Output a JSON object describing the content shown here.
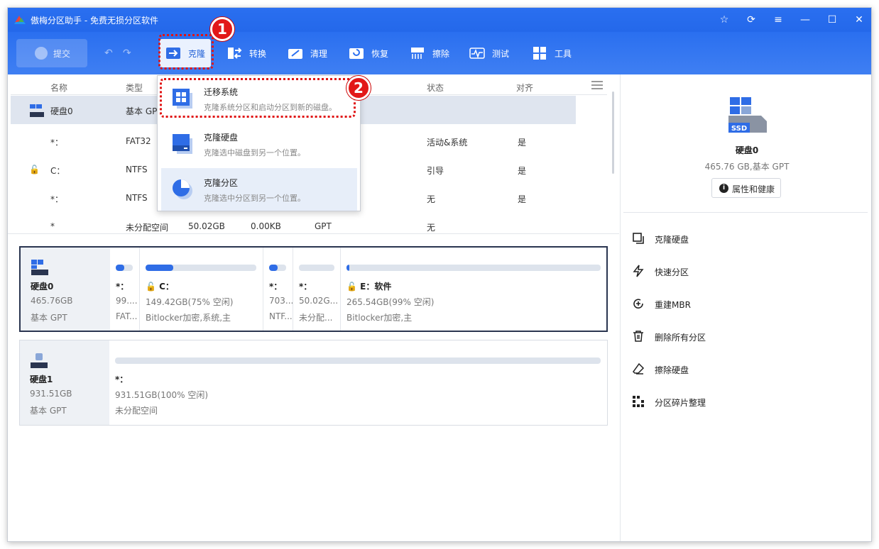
{
  "window": {
    "title": "傲梅分区助手 - 免费无损分区软件"
  },
  "toolbar": {
    "submit": "提交",
    "items": [
      {
        "label": "克隆",
        "icon": "clone-icon"
      },
      {
        "label": "转换",
        "icon": "convert-icon"
      },
      {
        "label": "清理",
        "icon": "clean-icon"
      },
      {
        "label": "恢复",
        "icon": "recover-icon"
      },
      {
        "label": "擦除",
        "icon": "wipe-icon"
      },
      {
        "label": "测试",
        "icon": "test-icon"
      },
      {
        "label": "工具",
        "icon": "tools-icon"
      }
    ]
  },
  "badges": [
    "1",
    "2"
  ],
  "table": {
    "headers": {
      "name": "名称",
      "type": "类型",
      "status": "状态",
      "align": "对齐"
    },
    "rows": [
      {
        "name": "硬盘0",
        "type": "基本 GPT",
        "status": "",
        "align": ""
      },
      {
        "name": "*：",
        "type": "FAT32",
        "status": "活动&系统",
        "align": "是"
      },
      {
        "name": "C：",
        "type": "NTFS",
        "status": "引导",
        "align": "是"
      },
      {
        "name": "*：",
        "type": "NTFS",
        "status": "无",
        "align": "是"
      },
      {
        "name": "*",
        "type": "未分配空间",
        "size": "50.02GB",
        "used": "0.00KB",
        "fs": "GPT",
        "status": "无",
        "align": ""
      }
    ]
  },
  "clone_menu": {
    "items": [
      {
        "title": "迁移系统",
        "desc": "克隆系统分区和启动分区到新的磁盘。"
      },
      {
        "title": "克隆硬盘",
        "desc": "克隆选中磁盘到另一个位置。"
      },
      {
        "title": "克隆分区",
        "desc": "克隆选中分区到另一个位置。"
      }
    ]
  },
  "disks": [
    {
      "name": "硬盘0",
      "size": "465.76GB",
      "type": "基本 GPT",
      "partitions": [
        {
          "name": "*：",
          "size": "99....",
          "fs": "FAT...",
          "fill": 0.5
        },
        {
          "name": "C：",
          "size": "149.42GB(75% 空闲)",
          "fs": "Bitlocker加密,系统,主",
          "fill": 0.25
        },
        {
          "name": "*：",
          "size": "703...",
          "fs": "NTF...",
          "fill": 0.5
        },
        {
          "name": "*：",
          "size": "50.02G...",
          "fs": "未分配...",
          "fill": 0
        },
        {
          "name": "E：软件",
          "size": "265.54GB(99% 空闲)",
          "fs": "Bitlocker加密,主",
          "fill": 0.01
        }
      ]
    },
    {
      "name": "硬盘1",
      "size": "931.51GB",
      "type": "基本 GPT",
      "partitions": [
        {
          "name": "*：",
          "size": "931.51GB(100% 空闲)",
          "fs": "未分配空间",
          "fill": 0
        }
      ]
    }
  ],
  "right_panel": {
    "disk_name": "硬盘0",
    "disk_sub": "465.76 GB,基本 GPT",
    "props_button": "属性和健康",
    "ssd_label": "SSD",
    "operations": [
      {
        "label": "克隆硬盘",
        "icon": "clone-disk-icon"
      },
      {
        "label": "快速分区",
        "icon": "quick-partition-icon"
      },
      {
        "label": "重建MBR",
        "icon": "rebuild-mbr-icon"
      },
      {
        "label": "删除所有分区",
        "icon": "delete-all-partitions-icon"
      },
      {
        "label": "擦除硬盘",
        "icon": "wipe-disk-icon"
      },
      {
        "label": "分区碎片整理",
        "icon": "defrag-icon"
      }
    ]
  },
  "colors": {
    "accent": "#2a6ff0",
    "highlight_red": "#e01414",
    "fill_blue": "#2f6de6"
  }
}
